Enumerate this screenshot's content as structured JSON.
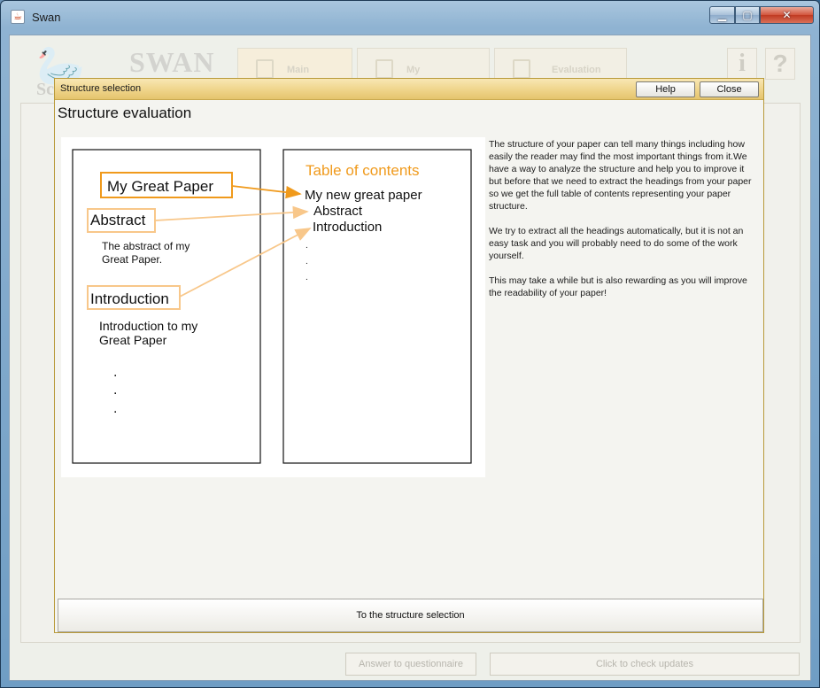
{
  "window": {
    "title": "Swan",
    "controls": {
      "minimize": "▁",
      "maximize": "▢",
      "close": "✕"
    }
  },
  "background_app": {
    "brand": "SWAN",
    "brand_prefix": "Sc",
    "tabs": [
      {
        "label": "Main",
        "icon": "document-icon"
      },
      {
        "label": "My",
        "icon": "pen-icon"
      },
      {
        "label": "Evaluation",
        "icon": "cards-icon"
      }
    ],
    "info_button": "i",
    "help_button": "?",
    "bottom_buttons": {
      "answer": "Answer to questionnaire",
      "updates": "Click to check updates"
    }
  },
  "dialog": {
    "title": "Structure selection",
    "help_label": "Help",
    "close_label": "Close",
    "heading": "Structure evaluation",
    "figure": {
      "doc_heading_title": "My Great Paper",
      "doc_heading_abstract": "Abstract",
      "doc_abstract_text_1": "The abstract of my",
      "doc_abstract_text_2": "Great Paper.",
      "doc_heading_intro": "Introduction",
      "doc_intro_text_1": "Introduction to my",
      "doc_intro_text_2": "Great Paper",
      "toc_title": "Table of contents",
      "toc_entry_1": "My new great paper",
      "toc_entry_2": "Abstract",
      "toc_entry_3": "Introduction",
      "ellipsis_dot": "."
    },
    "description": [
      "The structure of your paper can tell many things including how easily the reader may find the most important things from it.We have a way to analyze the structure and help you to improve it but before that we need to extract the headings from your paper so we get the full table of contents representing your paper structure.",
      "We try to extract all the headings automatically, but it is not an easy task and you will probably need to do some of the work yourself.",
      "This may take a while but is also rewarding as you will improve the readability of your paper!"
    ],
    "structure_button": "To the structure selection"
  },
  "colors": {
    "accent_orange": "#f09a1c",
    "arrow_light": "#f8c78a",
    "dialog_title": "#efd48a"
  }
}
